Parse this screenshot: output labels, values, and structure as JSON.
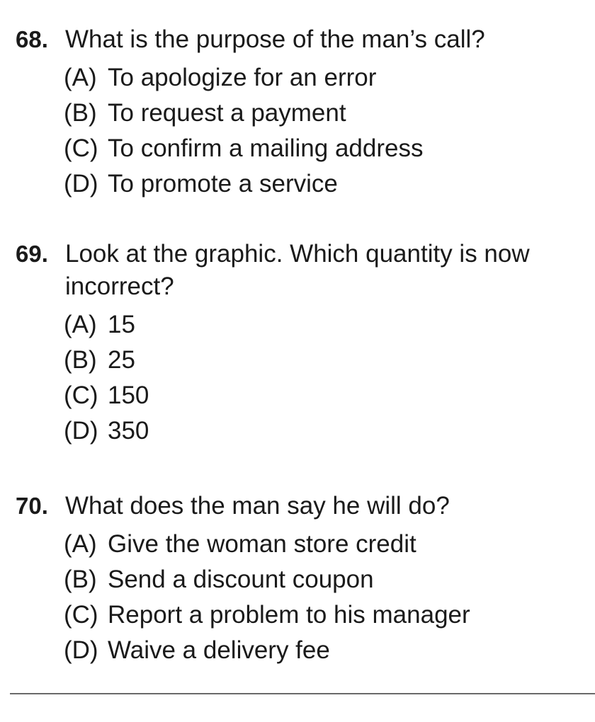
{
  "questions": [
    {
      "number": "68.",
      "text": "What is the purpose of the man’s call?",
      "options": [
        {
          "letter": "(A)",
          "text": "To apologize for an error"
        },
        {
          "letter": "(B)",
          "text": "To request a payment"
        },
        {
          "letter": "(C)",
          "text": "To confirm a mailing address"
        },
        {
          "letter": "(D)",
          "text": "To promote a service"
        }
      ]
    },
    {
      "number": "69.",
      "text": "Look at the graphic. Which quantity is now incorrect?",
      "options": [
        {
          "letter": "(A)",
          "text": "15"
        },
        {
          "letter": "(B)",
          "text": "25"
        },
        {
          "letter": "(C)",
          "text": "150"
        },
        {
          "letter": "(D)",
          "text": "350"
        }
      ]
    },
    {
      "number": "70.",
      "text": "What does the man say he will do?",
      "options": [
        {
          "letter": "(A)",
          "text": "Give the woman store credit"
        },
        {
          "letter": "(B)",
          "text": "Send a discount coupon"
        },
        {
          "letter": "(C)",
          "text": "Report a problem to his manager"
        },
        {
          "letter": "(D)",
          "text": "Waive a delivery fee"
        }
      ]
    }
  ]
}
